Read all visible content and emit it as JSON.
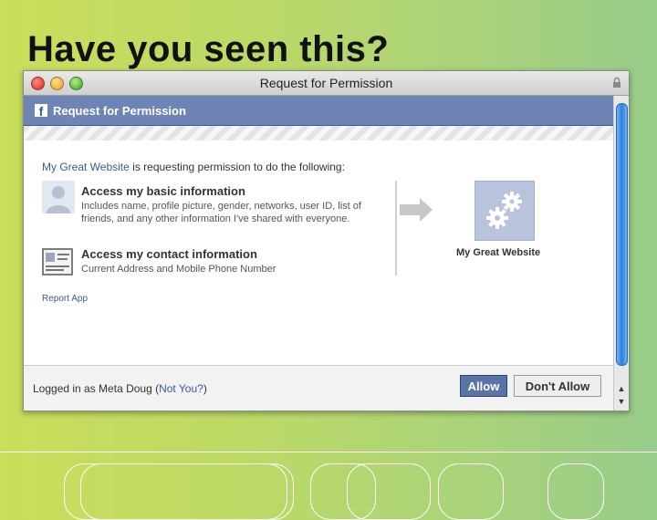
{
  "slide": {
    "title": "Have you seen this?"
  },
  "window": {
    "title": "Request for Permission"
  },
  "dialog": {
    "header_title": "Request for Permission",
    "app_name": "My Great Website",
    "request_suffix": " is requesting permission to do the following:",
    "permissions": [
      {
        "title": "Access my basic information",
        "description": "Includes name, profile picture, gender, networks, user ID, list of friends, and any other information I've shared with everyone.",
        "icon": "profile-silhouette-icon"
      },
      {
        "title": "Access my contact information",
        "description": "Current Address and Mobile Phone Number",
        "icon": "contact-card-icon"
      }
    ],
    "target_app_label": "My Great Website",
    "report_link": "Report App"
  },
  "footer": {
    "logged_prefix": "Logged in as Meta Doug (",
    "not_you": "Not You?",
    "logged_suffix": ")",
    "allow_label": "Allow",
    "deny_label": "Don't Allow"
  },
  "colors": {
    "facebook_blue": "#3b5998",
    "header_bar": "#6d84b4",
    "allow_button": "#5b74a8",
    "scroll_thumb": "#2f7fd8"
  }
}
